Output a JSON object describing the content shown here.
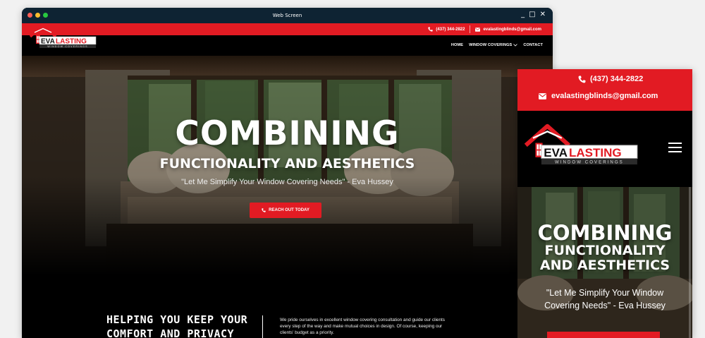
{
  "window": {
    "title": "Web Screen",
    "controls": [
      "_",
      "□",
      "✕"
    ]
  },
  "contact": {
    "phone": "(437) 344-2822",
    "email": "evalastingblinds@gmail.com"
  },
  "logo": {
    "word_a": "EVA",
    "word_b": "LASTING",
    "tagline": "WINDOW COVERINGS"
  },
  "nav": {
    "home": "HOME",
    "window_coverings": "WINDOW COVERINGS",
    "contact": "CONTACT"
  },
  "hero": {
    "title": "COMBINING",
    "subtitle": "FUNCTIONALITY AND AESTHETICS",
    "quote": "\"Let Me Simplify Your Window Covering Needs\" - Eva Hussey",
    "cta": "REACH OUT TODAY"
  },
  "about": {
    "heading_line1": "HELPING YOU KEEP YOUR",
    "heading_line2": "COMFORT AND PRIVACY",
    "body": "We pride ourselves in excellent window covering consultation and guide our clients every step of the way and make mutual choices in design. Of course, keeping our clients' budget as a priority."
  },
  "mobile": {
    "title": "COMBINING",
    "sub_line1": "FUNCTIONALITY",
    "sub_line2": "AND AESTHETICS",
    "quote_line1": "\"Let Me Simplify Your Window",
    "quote_line2": "Covering Needs\" - Eva Hussey"
  },
  "colors": {
    "brand_red": "#e21b23",
    "titlebar": "#0e2333",
    "black": "#000000"
  },
  "icons": {
    "phone": "phone-icon",
    "email": "envelope-icon",
    "menu": "hamburger-icon",
    "chevron": "chevron-down-icon"
  }
}
